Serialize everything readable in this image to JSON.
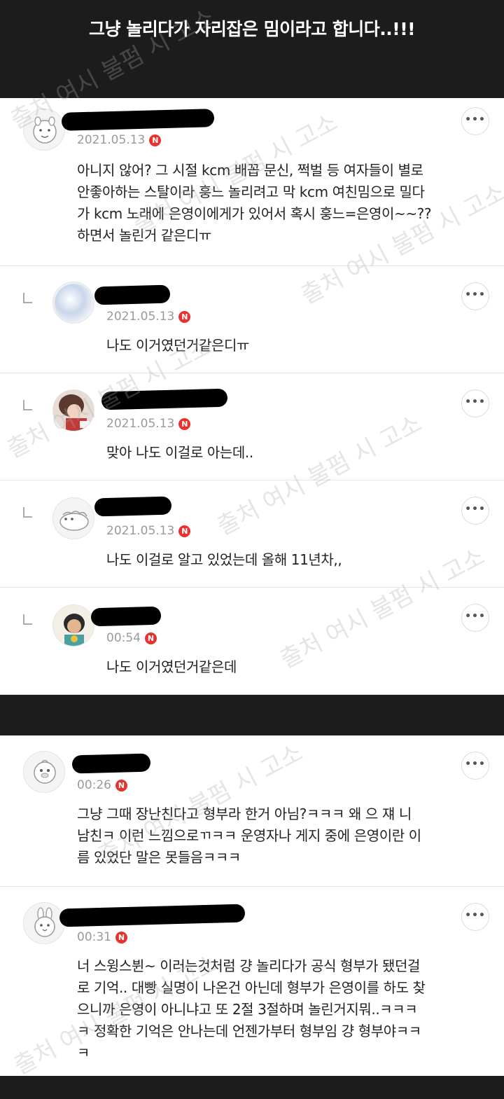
{
  "header": {
    "title": "그냥 놀리다가 자리잡은 밈이라고 합니다..!!!"
  },
  "comments": [
    {
      "date": "2021.05.13",
      "badge": "N",
      "more": "•••",
      "avatar": "alpaca-avatar",
      "text": "아니지 않어? 그 시절 kcm 배꼽 문신, 쩍벌 등 여자들이 별로\n안좋아하는 스탈이라 훙느 놀리려고 막 kcm 여친밈으로 밀다\n가 kcm 노래에 은영이에게가 있어서 혹시 훙느=은영이~~??\n하면서 놀린거 같은디ㅠ"
    },
    {
      "date": "2021.05.13",
      "badge": "N",
      "more": "•••",
      "avatar": "pearl-avatar",
      "text": "나도 이거였던거같은디ㅠ"
    },
    {
      "date": "2021.05.13",
      "badge": "N",
      "more": "•••",
      "avatar": "photo-avatar",
      "text": "맞아 나도 이걸로 아는데.."
    },
    {
      "date": "2021.05.13",
      "badge": "N",
      "more": "•••",
      "avatar": "sheep-avatar",
      "text": "나도 이걸로 알고 있었는데 올해 11년차,,"
    },
    {
      "date": "00:54",
      "badge": "N",
      "more": "•••",
      "avatar": "girl-avatar",
      "text": "나도 이거였던거같은데"
    },
    {
      "date": "00:26",
      "badge": "N",
      "more": "•••",
      "avatar": "duck-avatar",
      "text": "그냥 그때 장난친다고 형부라 한거 아님?ㅋㅋㅋ 왜 으 쟤 니\n남친ㅋ 이런 느낌으로ㄲㅋㅋ 운영자나 게지 중에 은영이란 이\n름 있었단 말은 못들음ㅋㅋㅋ"
    },
    {
      "date": "00:31",
      "badge": "N",
      "more": "•••",
      "avatar": "rabbit-avatar",
      "text": "너 스윙스뷘~ 이러는것처럼 걍 놀리다가 공식 형부가 됐던걸\n로 기억.. 대빵 실명이 나온건 아닌데 형부가 은영이를 하도 찾\n으니까 은영이 아니냐고 또 2절 3절하며 놀린거지뭐..ㅋㅋㅋ\nㅋ 정확한 기억은 안나는데 언젠가부터 형부임 걍 형부야ㅋㅋ\nㅋ"
    }
  ],
  "watermark": "출처 여시 불펌 시 고소"
}
